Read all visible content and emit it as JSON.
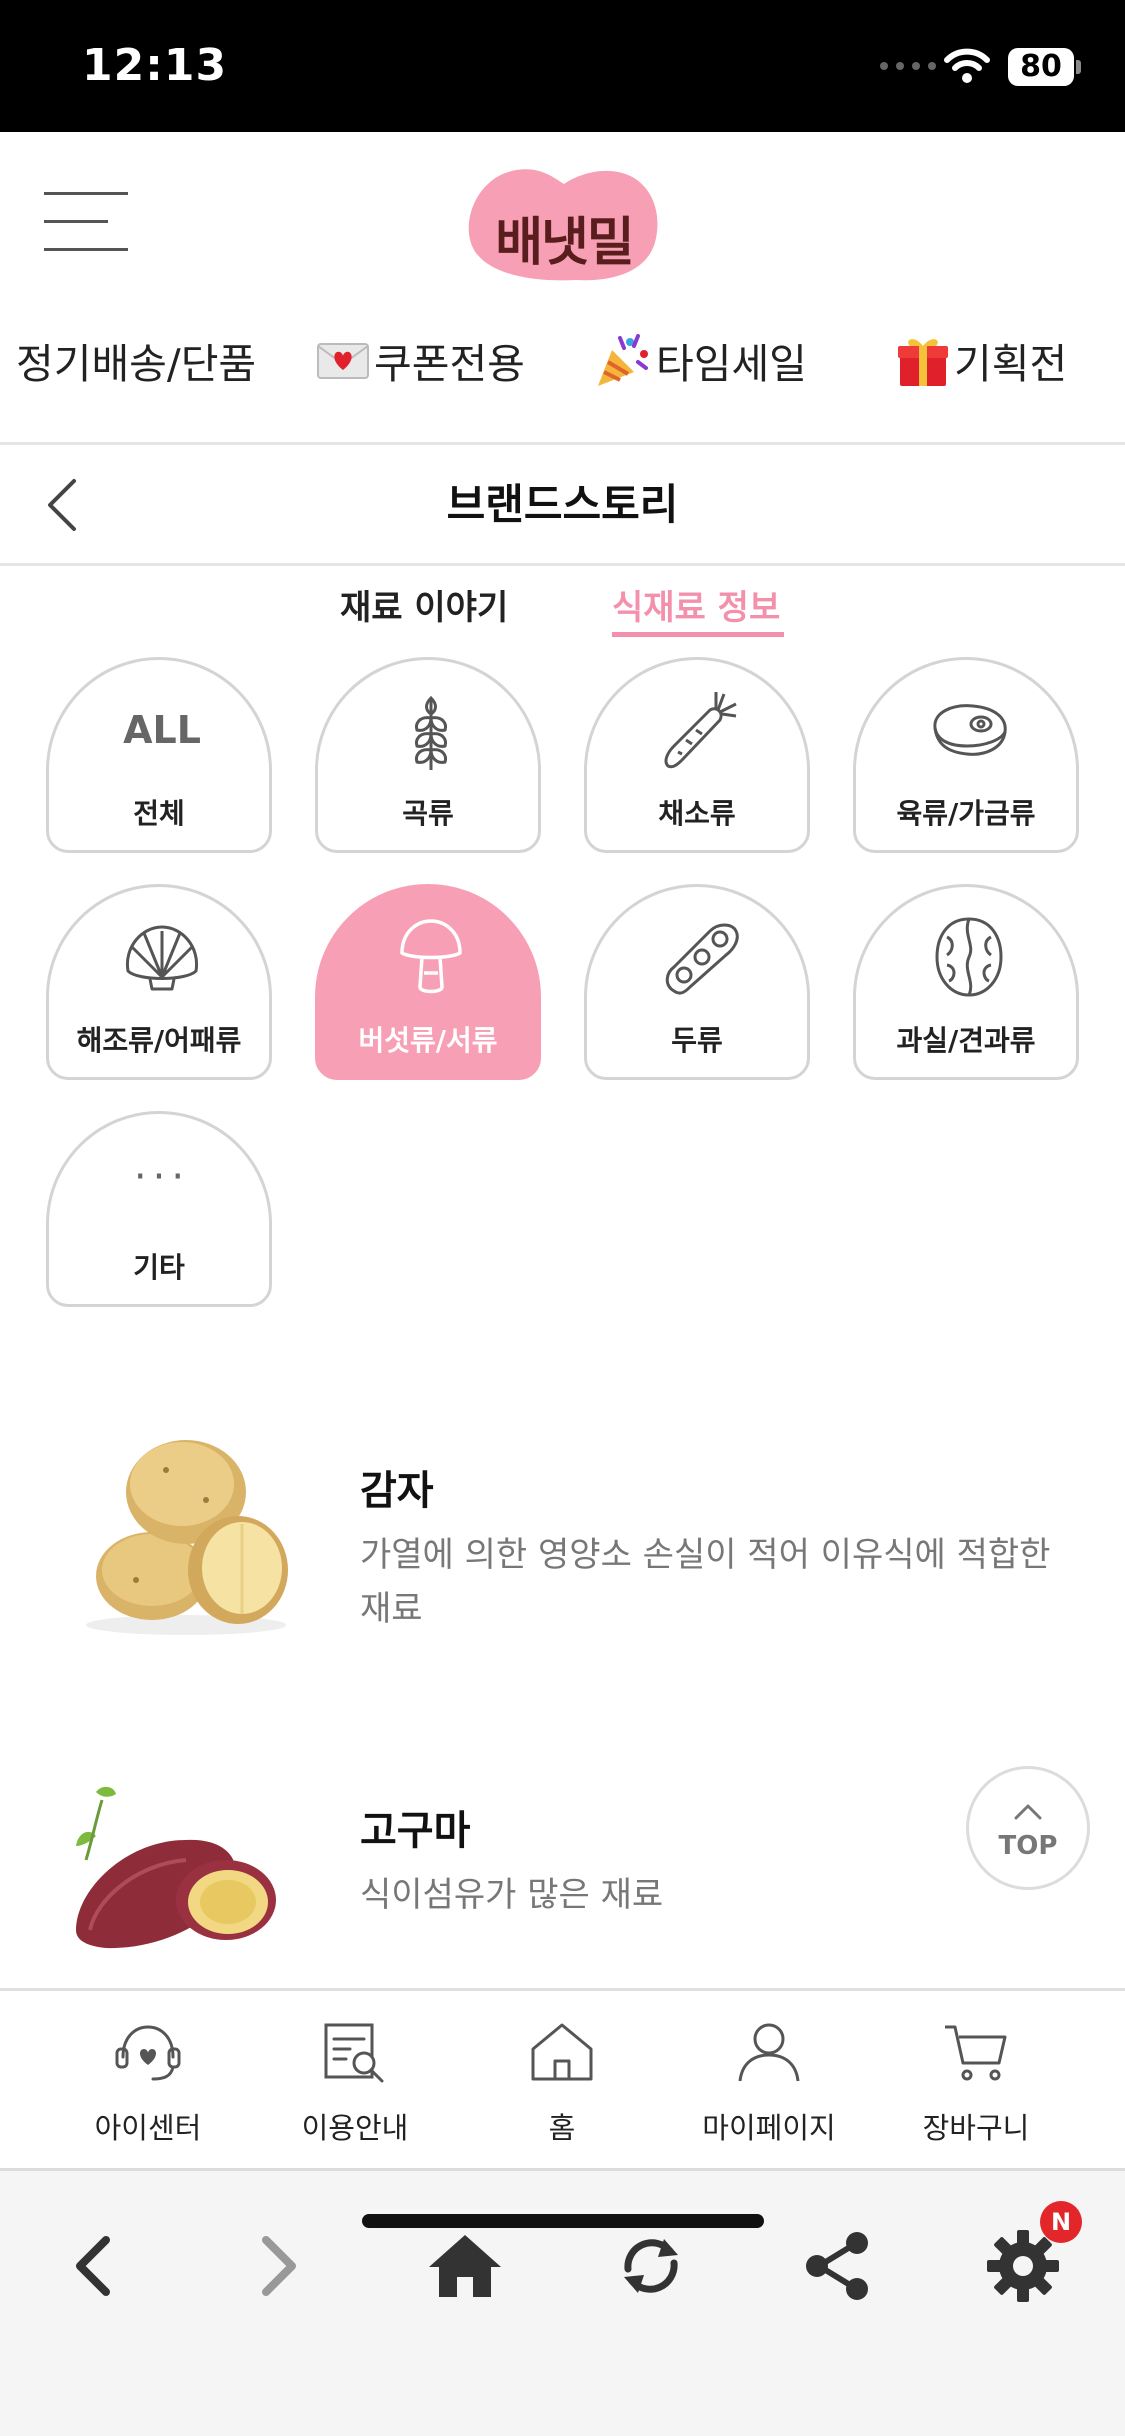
{
  "status_bar": {
    "time": "12:13",
    "battery": "80"
  },
  "header": {
    "logo_text": "배냇밀",
    "brand_color": "#f7a0b5"
  },
  "category_nav": [
    {
      "label": "정기배송/단품",
      "icon": ""
    },
    {
      "label": "쿠폰전용",
      "icon": "love-letter-icon"
    },
    {
      "label": "타임세일",
      "icon": "party-popper-icon"
    },
    {
      "label": "기획전",
      "icon": "gift-icon"
    }
  ],
  "page": {
    "title": "브랜드스토리"
  },
  "sub_tabs": [
    {
      "label": "재료 이야기",
      "active": false
    },
    {
      "label": "식재료 정보",
      "active": true
    }
  ],
  "categories": [
    {
      "label": "전체",
      "icon_text": "ALL",
      "icon": "all-icon",
      "active": false
    },
    {
      "label": "곡류",
      "icon": "wheat-icon",
      "active": false
    },
    {
      "label": "채소류",
      "icon": "carrot-icon",
      "active": false
    },
    {
      "label": "육류/가금류",
      "icon": "meat-icon",
      "active": false
    },
    {
      "label": "해조류/어패류",
      "icon": "shell-icon",
      "active": false
    },
    {
      "label": "버섯류/서류",
      "icon": "mushroom-icon",
      "active": true
    },
    {
      "label": "두류",
      "icon": "bean-icon",
      "active": false
    },
    {
      "label": "과실/견과류",
      "icon": "walnut-icon",
      "active": false
    },
    {
      "label": "기타",
      "icon_text": "···",
      "icon": "more-icon",
      "active": false
    }
  ],
  "foods": [
    {
      "name": "감자",
      "description": "가열에 의한 영양소 손실이 적어 이유식에 적합한 재료"
    },
    {
      "name": "고구마",
      "description": "식이섬유가 많은 재료"
    }
  ],
  "top_button": {
    "label": "TOP"
  },
  "app_tabs": [
    {
      "label": "아이센터",
      "icon": "headset-heart-icon"
    },
    {
      "label": "이용안내",
      "icon": "document-search-icon"
    },
    {
      "label": "홈",
      "icon": "house-outline-icon"
    },
    {
      "label": "마이페이지",
      "icon": "person-icon"
    },
    {
      "label": "장바구니",
      "icon": "cart-icon"
    }
  ],
  "browser_bar": {
    "buttons": [
      "back-arrow-icon",
      "forward-arrow-icon",
      "home-icon",
      "refresh-icon",
      "share-icon",
      "settings-icon"
    ],
    "settings_badge": "N",
    "badge_color": "#e3262a"
  }
}
